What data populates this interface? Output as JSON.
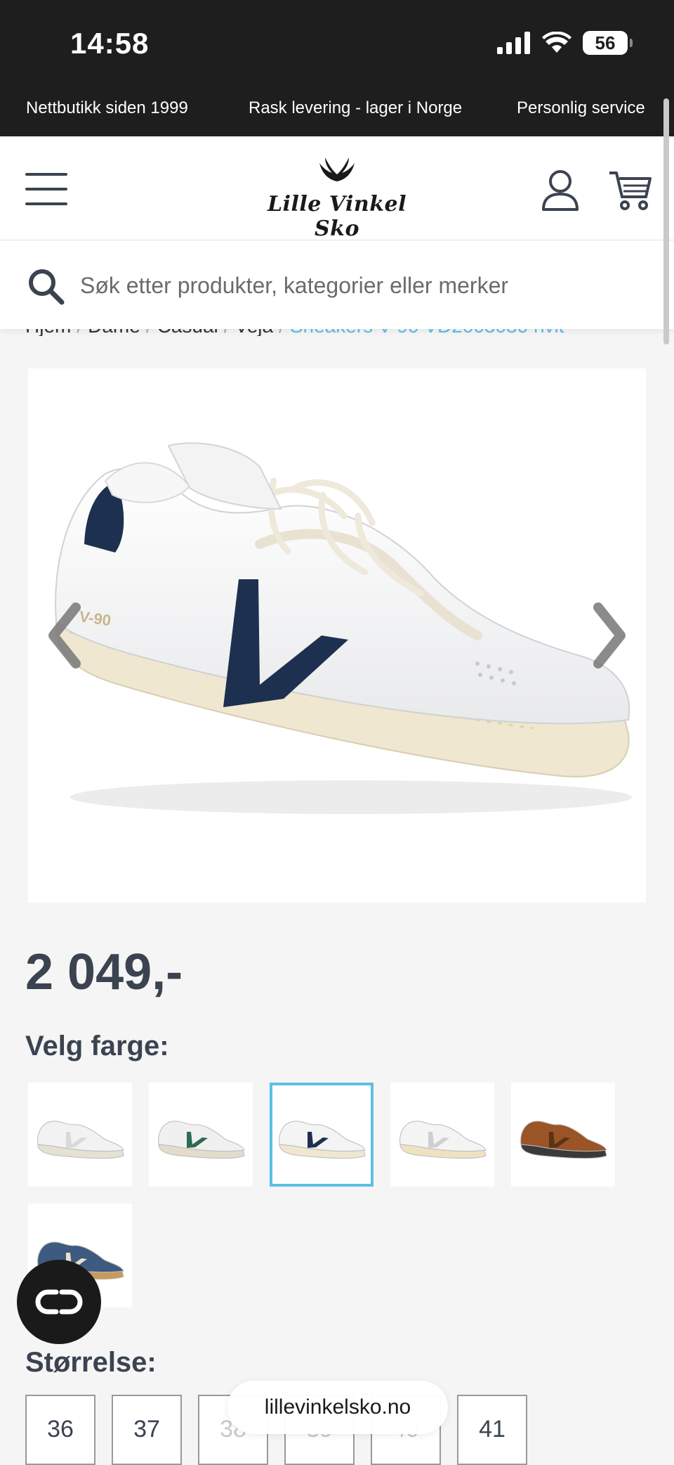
{
  "status_bar": {
    "time": "14:58",
    "battery": "56"
  },
  "promo": [
    "Nettbutikk siden 1999",
    "Rask levering - lager i Norge",
    "Personlig service"
  ],
  "header": {
    "logo": "Lille Vinkel Sko"
  },
  "search": {
    "placeholder": "Søk etter produkter, kategorier eller merker"
  },
  "breadcrumb": {
    "items": [
      "Hjem",
      "Dame",
      "Casual",
      "Veja"
    ],
    "current": "Sneakers V-90 VD2003030 hvit"
  },
  "product": {
    "price": "2 049,-"
  },
  "color_section": {
    "label": "Velg farge:",
    "swatches": [
      {
        "name": "white-beige",
        "accent": "#d9d9d9",
        "upper": "#f2f2f2",
        "sole": "#e5e1d4"
      },
      {
        "name": "white-green",
        "accent": "#2f6b4f",
        "upper": "#f0f0f0",
        "sole": "#e3dccb"
      },
      {
        "name": "white-navy",
        "accent": "#1e3050",
        "upper": "#f4f4f4",
        "sole": "#efe7cf",
        "selected": true
      },
      {
        "name": "white-grey",
        "accent": "#cfcfcf",
        "upper": "#f4f4f4",
        "sole": "#eee2c2"
      },
      {
        "name": "brown-suede",
        "accent": "#5a3318",
        "upper": "#9b5425",
        "sole": "#3a3a3a"
      },
      {
        "name": "navy-gum",
        "accent": "#e9e1cf",
        "upper": "#3d5a80",
        "sole": "#c99a5c"
      }
    ]
  },
  "size_section": {
    "label": "Størrelse:",
    "sizes": [
      "36",
      "37",
      "38",
      "39",
      "40",
      "41"
    ]
  },
  "browser": {
    "url": "lillevinkelsko.no"
  },
  "colors": {
    "accent": "#5bc0e6",
    "dark": "#1e1e1e",
    "text": "#3b4350"
  }
}
